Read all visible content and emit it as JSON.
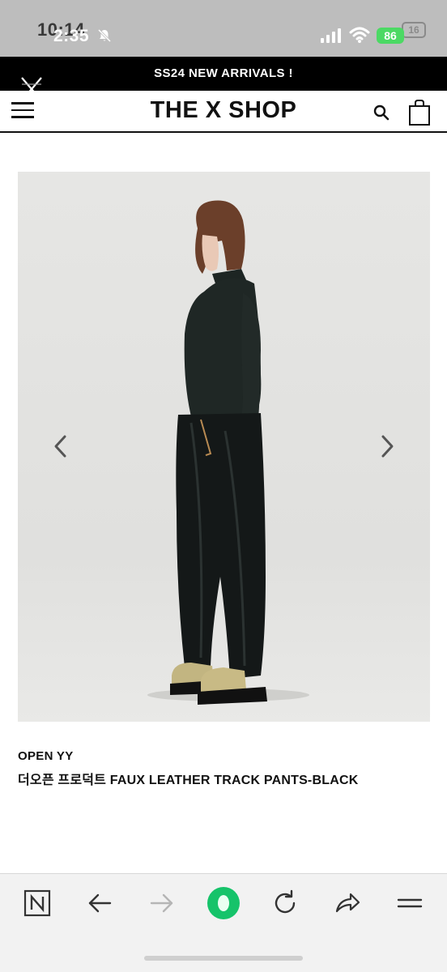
{
  "status_bar": {
    "time": "2:35",
    "time_ghost": "10:14",
    "battery": "86",
    "battery_ghost": "16"
  },
  "promo_banner": {
    "text": "SS24 NEW ARRIVALS !"
  },
  "header": {
    "title": "THE X SHOP"
  },
  "product": {
    "brand": "OPEN YY",
    "name": "더오픈 프로덕트 FAUX LEATHER TRACK PANTS-BLACK"
  },
  "colors": {
    "accent_green": "#16c36a",
    "battery_green": "#4cd964",
    "banner_black": "#000000"
  },
  "toolbar": {
    "icons": [
      "naver-n-icon",
      "back-arrow-icon",
      "forward-arrow-icon",
      "green-dot-icon",
      "refresh-icon",
      "share-icon",
      "menu-lines-icon"
    ]
  }
}
